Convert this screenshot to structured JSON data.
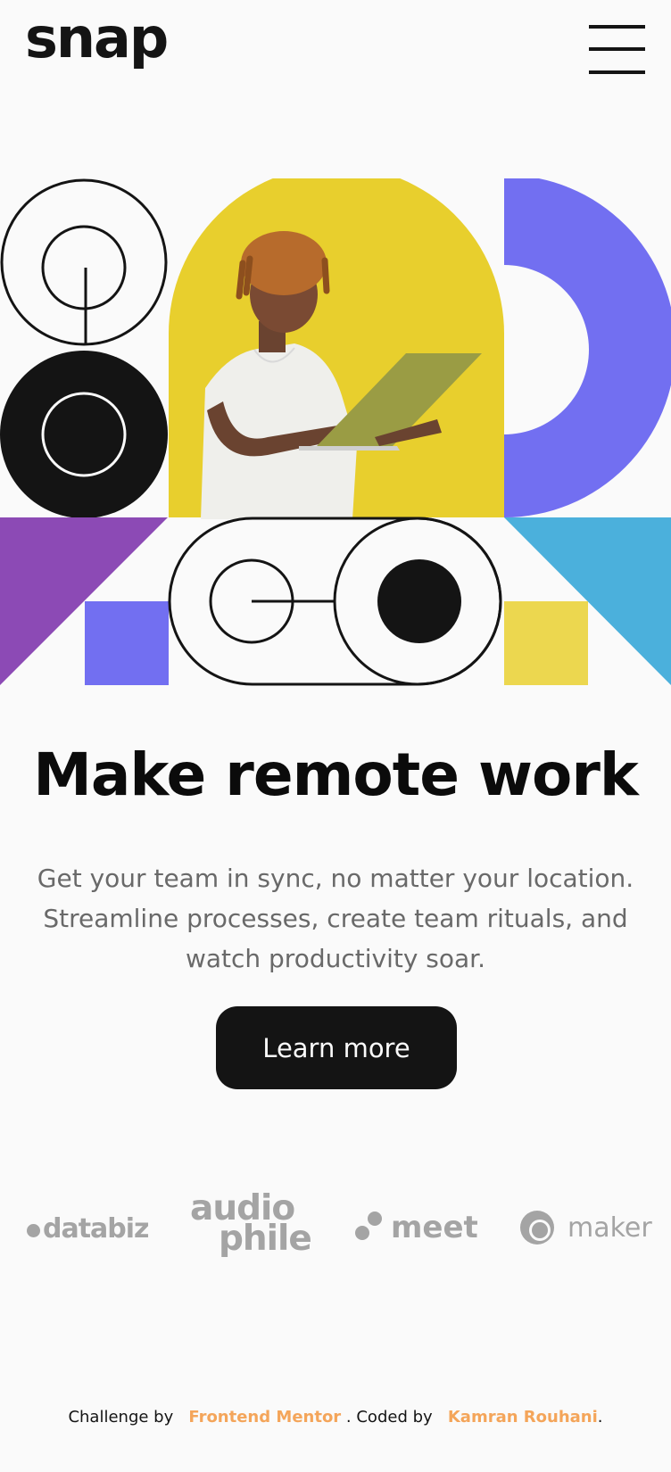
{
  "header": {
    "logo": "snap",
    "menu_icon": "hamburger-menu-icon"
  },
  "hero": {
    "illustration": "person-with-laptop-geometric-collage",
    "colors": {
      "yellow": "#e8cf2d",
      "purple": "#726ff1",
      "violet": "#8c4ab5",
      "cyan": "#4bb0dc",
      "black": "#141414",
      "pale_yellow": "#ecd74f"
    },
    "headline": "Make remote work",
    "subtext": "Get your team in sync, no matter your location. Streamline processes, create team rituals, and watch productivity soar.",
    "cta_label": "Learn more"
  },
  "clients": {
    "databiz": "databiz",
    "audiophile_line1": "audio",
    "audiophile_line2": "phile",
    "meet": "meet",
    "maker": "maker"
  },
  "footer": {
    "prefix": "Challenge by",
    "challenge_link": "Frontend Mentor",
    "middle": ". Coded by",
    "author_link": "Kamran Rouhani",
    "suffix": ".",
    "accent_color": "#f4a55a"
  }
}
